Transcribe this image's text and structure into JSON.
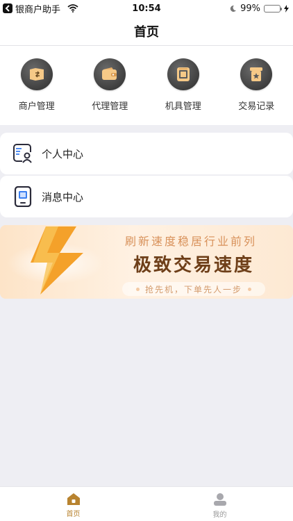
{
  "status_bar": {
    "carrier": "银商户助手",
    "time": "10:54",
    "battery": "99%"
  },
  "nav": {
    "title": "首页"
  },
  "quick_menu": [
    {
      "label": "商户管理",
      "icon": "merchant-icon"
    },
    {
      "label": "代理管理",
      "icon": "wallet-icon"
    },
    {
      "label": "机具管理",
      "icon": "pos-terminal-icon"
    },
    {
      "label": "交易记录",
      "icon": "transaction-record-icon"
    }
  ],
  "cards": [
    {
      "label": "个人中心",
      "icon": "profile-card-icon"
    },
    {
      "label": "消息中心",
      "icon": "message-device-icon"
    }
  ],
  "banner": {
    "subtitle": "刷新速度稳居行业前列",
    "title": "极致交易速度",
    "tagline": "抢先机，下单先人一步"
  },
  "tabbar": {
    "active_color": "#b8832f",
    "inactive_color": "#999999",
    "items": [
      {
        "label": "首页",
        "icon": "home-icon",
        "active": true
      },
      {
        "label": "我的",
        "icon": "user-icon",
        "active": false
      }
    ]
  }
}
